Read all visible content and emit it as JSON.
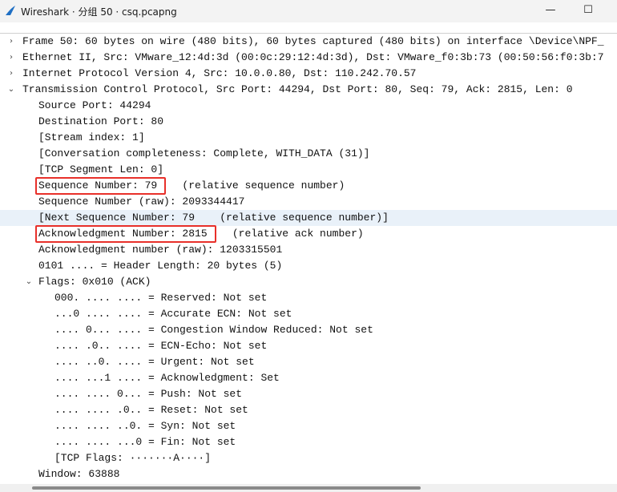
{
  "window": {
    "title": "Wireshark · 分组 50 · csq.pcapng",
    "minimize_glyph": "—",
    "maximize_glyph": "☐"
  },
  "tree": [
    {
      "indent": 0,
      "arrow": "›",
      "text": "Frame 50: 60 bytes on wire (480 bits), 60 bytes captured (480 bits) on interface \\Device\\NPF_"
    },
    {
      "indent": 0,
      "arrow": "›",
      "text": "Ethernet II, Src: VMware_12:4d:3d (00:0c:29:12:4d:3d), Dst: VMware_f0:3b:73 (00:50:56:f0:3b:7"
    },
    {
      "indent": 0,
      "arrow": "›",
      "text": "Internet Protocol Version 4, Src: 10.0.0.80, Dst: 110.242.70.57"
    },
    {
      "indent": 0,
      "arrow": "⌄",
      "text": "Transmission Control Protocol, Src Port: 44294, Dst Port: 80, Seq: 79, Ack: 2815, Len: 0"
    },
    {
      "indent": 1,
      "arrow": "",
      "text": "Source Port: 44294"
    },
    {
      "indent": 1,
      "arrow": "",
      "text": "Destination Port: 80"
    },
    {
      "indent": 1,
      "arrow": "",
      "text": "[Stream index: 1]"
    },
    {
      "indent": 1,
      "arrow": "",
      "text": "[Conversation completeness: Complete, WITH_DATA (31)]"
    },
    {
      "indent": 1,
      "arrow": "",
      "text": "[TCP Segment Len: 0]"
    },
    {
      "indent": 1,
      "arrow": "",
      "text": "Sequence Number: 79    (relative sequence number)",
      "boxed": true
    },
    {
      "indent": 1,
      "arrow": "",
      "text": "Sequence Number (raw): 2093344417"
    },
    {
      "indent": 1,
      "arrow": "",
      "text": "[Next Sequence Number: 79    (relative sequence number)]",
      "highlight": true
    },
    {
      "indent": 1,
      "arrow": "",
      "text": "Acknowledgment Number: 2815    (relative ack number)",
      "boxed": true
    },
    {
      "indent": 1,
      "arrow": "",
      "text": "Acknowledgment number (raw): 1203315501"
    },
    {
      "indent": 1,
      "arrow": "",
      "text": "0101 .... = Header Length: 20 bytes (5)"
    },
    {
      "indent": 1,
      "arrow": "⌄",
      "text": "Flags: 0x010 (ACK)"
    },
    {
      "indent": 2,
      "arrow": "",
      "text": "000. .... .... = Reserved: Not set"
    },
    {
      "indent": 2,
      "arrow": "",
      "text": "...0 .... .... = Accurate ECN: Not set"
    },
    {
      "indent": 2,
      "arrow": "",
      "text": ".... 0... .... = Congestion Window Reduced: Not set"
    },
    {
      "indent": 2,
      "arrow": "",
      "text": ".... .0.. .... = ECN-Echo: Not set"
    },
    {
      "indent": 2,
      "arrow": "",
      "text": ".... ..0. .... = Urgent: Not set"
    },
    {
      "indent": 2,
      "arrow": "",
      "text": ".... ...1 .... = Acknowledgment: Set"
    },
    {
      "indent": 2,
      "arrow": "",
      "text": ".... .... 0... = Push: Not set"
    },
    {
      "indent": 2,
      "arrow": "",
      "text": ".... .... .0.. = Reset: Not set"
    },
    {
      "indent": 2,
      "arrow": "",
      "text": ".... .... ..0. = Syn: Not set"
    },
    {
      "indent": 2,
      "arrow": "",
      "text": ".... .... ...0 = Fin: Not set"
    },
    {
      "indent": 2,
      "arrow": "",
      "text": "[TCP Flags: ·······A····]"
    },
    {
      "indent": 1,
      "arrow": "",
      "text": "Window: 63888"
    }
  ],
  "colors": {
    "highlight_row": "#e9f1f9",
    "annotation_box": "#e8302a",
    "shark_fin": "#1f6fc4"
  }
}
